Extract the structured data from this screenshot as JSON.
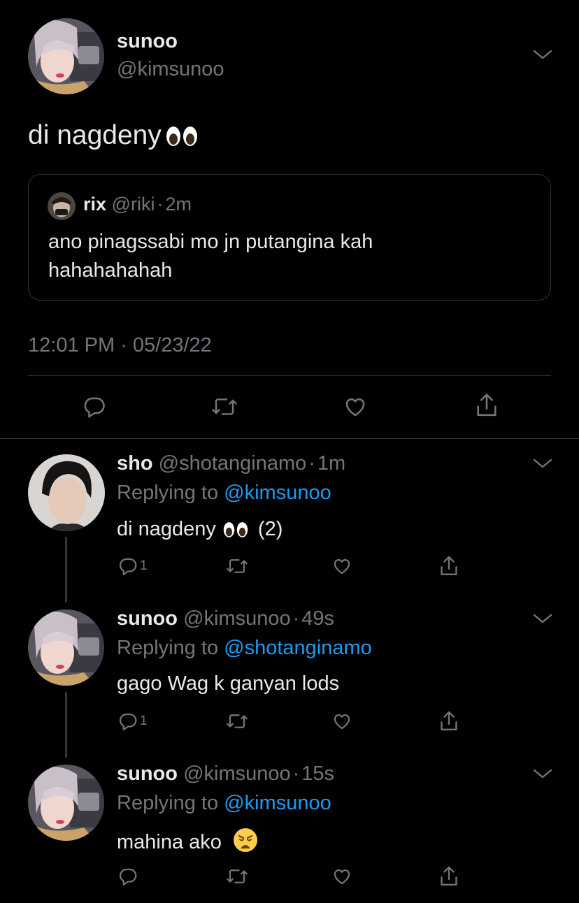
{
  "main_tweet": {
    "display_name": "sunoo",
    "handle": "@kimsunoo",
    "text": "di nagdeny",
    "quoted": {
      "display_name": "rix",
      "handle": "@riki",
      "time": "2m",
      "text_line1": "ano pinagssabi mo jn putangina kah",
      "text_line2": "hahahahahah"
    },
    "timestamp": "12:01 PM · 05/23/22"
  },
  "replies": [
    {
      "display_name": "sho",
      "handle": "@shotanginamo",
      "time": "1m",
      "replying_prefix": "Replying to",
      "replying_to": "@kimsunoo",
      "text": "di nagdeny",
      "suffix": "(2)",
      "reply_count": "1"
    },
    {
      "display_name": "sunoo",
      "handle": "@kimsunoo",
      "time": "49s",
      "replying_prefix": "Replying to",
      "replying_to": "@shotanginamo",
      "text": "gago Wag k ganyan lods",
      "reply_count": "1"
    },
    {
      "display_name": "sunoo",
      "handle": "@kimsunoo",
      "time": "15s",
      "replying_prefix": "Replying to",
      "replying_to": "@kimsunoo",
      "text": "mahina ako",
      "reply_count": ""
    }
  ],
  "separator": "·",
  "icons": {
    "reply": "reply-icon",
    "retweet": "retweet-icon",
    "like": "heart-icon",
    "share": "share-icon",
    "more": "chevron-down-icon",
    "eyes": "eyes-emoji",
    "weary": "weary-face-emoji"
  },
  "colors": {
    "background": "#000000",
    "text": "#e7e9ea",
    "muted": "#71767b",
    "link": "#1d9bf0",
    "border": "#2f3336"
  }
}
